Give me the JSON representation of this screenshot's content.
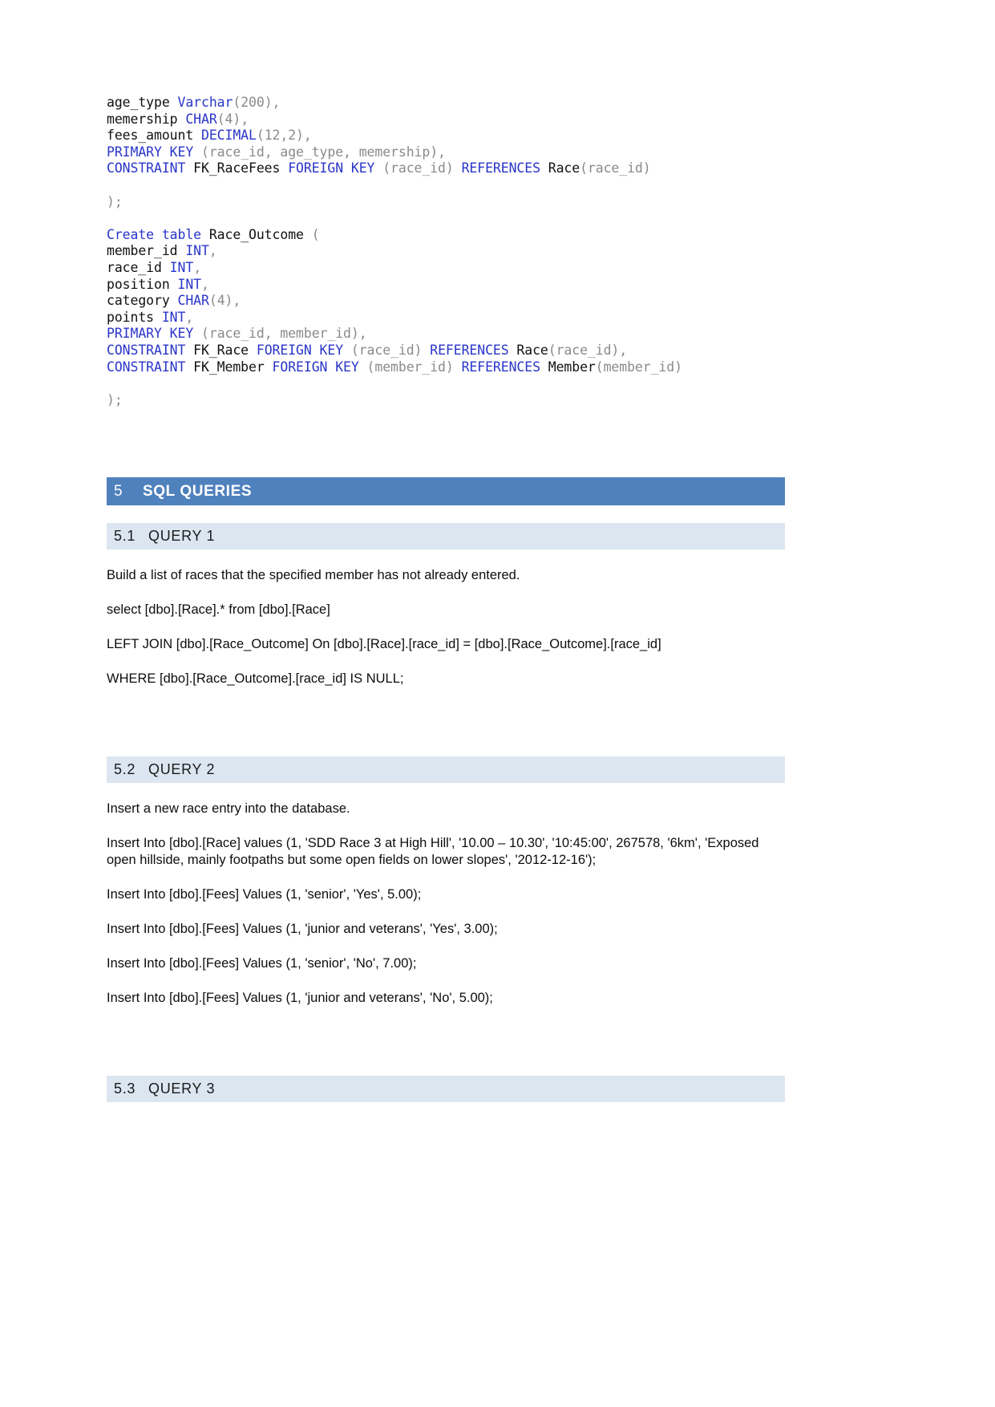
{
  "document": {
    "code_block": {
      "name": "sql-ddl-code",
      "lines": [
        [
          {
            "t": "age_type ",
            "s": "plain"
          },
          {
            "t": "Varchar",
            "s": "kw"
          },
          {
            "t": "(200),",
            "s": "punc"
          }
        ],
        [
          {
            "t": "memership ",
            "s": "plain"
          },
          {
            "t": "CHAR",
            "s": "kw"
          },
          {
            "t": "(4),",
            "s": "punc"
          }
        ],
        [
          {
            "t": "fees_amount ",
            "s": "plain"
          },
          {
            "t": "DECIMAL",
            "s": "kw"
          },
          {
            "t": "(12,2),",
            "s": "punc"
          }
        ],
        [
          {
            "t": "PRIMARY KEY",
            "s": "kw"
          },
          {
            "t": " (race_id, age_type, memership),",
            "s": "punc"
          }
        ],
        [
          {
            "t": "CONSTRAINT",
            "s": "kw"
          },
          {
            "t": " FK_RaceFees ",
            "s": "plain"
          },
          {
            "t": "FOREIGN KEY",
            "s": "kw"
          },
          {
            "t": " (race_id) ",
            "s": "punc"
          },
          {
            "t": "REFERENCES",
            "s": "kw"
          },
          {
            "t": " Race",
            "s": "plain"
          },
          {
            "t": "(race_id)",
            "s": "punc"
          }
        ],
        [],
        [
          {
            "t": ");",
            "s": "punc"
          }
        ],
        [],
        [
          {
            "t": "Create table",
            "s": "kw"
          },
          {
            "t": " Race_Outcome ",
            "s": "plain"
          },
          {
            "t": "(",
            "s": "punc"
          }
        ],
        [
          {
            "t": "member_id ",
            "s": "plain"
          },
          {
            "t": "INT",
            "s": "kw"
          },
          {
            "t": ",",
            "s": "punc"
          }
        ],
        [
          {
            "t": "race_id ",
            "s": "plain"
          },
          {
            "t": "INT",
            "s": "kw"
          },
          {
            "t": ",",
            "s": "punc"
          }
        ],
        [
          {
            "t": "position ",
            "s": "plain"
          },
          {
            "t": "INT",
            "s": "kw"
          },
          {
            "t": ",",
            "s": "punc"
          }
        ],
        [
          {
            "t": "category ",
            "s": "plain"
          },
          {
            "t": "CHAR",
            "s": "kw"
          },
          {
            "t": "(4),",
            "s": "punc"
          }
        ],
        [
          {
            "t": "points ",
            "s": "plain"
          },
          {
            "t": "INT",
            "s": "kw"
          },
          {
            "t": ",",
            "s": "punc"
          }
        ],
        [
          {
            "t": "PRIMARY KEY",
            "s": "kw"
          },
          {
            "t": " (race_id, member_id),",
            "s": "punc"
          }
        ],
        [
          {
            "t": "CONSTRAINT",
            "s": "kw"
          },
          {
            "t": " FK_Race ",
            "s": "plain"
          },
          {
            "t": "FOREIGN KEY",
            "s": "kw"
          },
          {
            "t": " (race_id) ",
            "s": "punc"
          },
          {
            "t": "REFERENCES",
            "s": "kw"
          },
          {
            "t": " Race",
            "s": "plain"
          },
          {
            "t": "(race_id),",
            "s": "punc"
          }
        ],
        [
          {
            "t": "CONSTRAINT",
            "s": "kw"
          },
          {
            "t": " FK_Member ",
            "s": "plain"
          },
          {
            "t": "FOREIGN KEY",
            "s": "kw"
          },
          {
            "t": " (member_id) ",
            "s": "punc"
          },
          {
            "t": "REFERENCES",
            "s": "kw"
          },
          {
            "t": " Member",
            "s": "plain"
          },
          {
            "t": "(member_id)",
            "s": "punc"
          }
        ],
        [],
        [
          {
            "t": ");",
            "s": "punc"
          }
        ]
      ]
    },
    "section": {
      "number": "5",
      "title": "SQL QUERIES",
      "bar_color": "#4f81bd",
      "text_color": "#ffffff"
    },
    "subsections": [
      {
        "number": "5.1",
        "title": "QUERY 1",
        "bar_color": "#dce6f1",
        "paragraphs": [
          "Build a list of races that the specified member has not already entered.",
          "select [dbo].[Race].* from [dbo].[Race]",
          "LEFT JOIN [dbo].[Race_Outcome] On [dbo].[Race].[race_id] = [dbo].[Race_Outcome].[race_id]",
          "WHERE [dbo].[Race_Outcome].[race_id] IS NULL;"
        ]
      },
      {
        "number": "5.2",
        "title": "QUERY 2",
        "bar_color": "#dce6f1",
        "paragraphs": [
          "Insert a new race entry into the database.",
          "Insert Into [dbo].[Race] values (1, 'SDD Race 3 at High Hill', '10.00 – 10.30', '10:45:00', 267578, '6km', 'Exposed open hillside, mainly footpaths but some open fields on lower slopes', '2012-12-16');",
          "Insert Into [dbo].[Fees] Values (1, 'senior', 'Yes', 5.00);",
          "Insert Into [dbo].[Fees] Values (1, 'junior and veterans', 'Yes', 3.00);",
          "Insert Into [dbo].[Fees] Values (1, 'senior', 'No', 7.00);",
          "Insert Into [dbo].[Fees] Values (1, 'junior and veterans', 'No', 5.00);"
        ]
      },
      {
        "number": "5.3",
        "title": "QUERY 3",
        "bar_color": "#dce6f1",
        "paragraphs": []
      }
    ]
  }
}
